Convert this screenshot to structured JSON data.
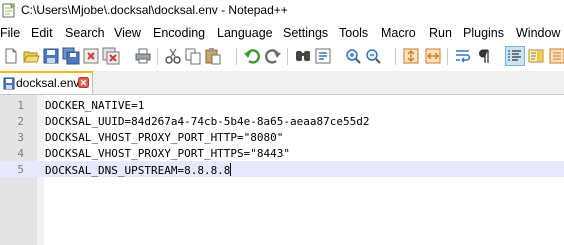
{
  "window": {
    "title": "C:\\Users\\Mjobe\\.docksal\\docksal.env - Notepad++",
    "icon": "notepadpp-icon"
  },
  "menu": [
    "File",
    "Edit",
    "Search",
    "View",
    "Encoding",
    "Language",
    "Settings",
    "Tools",
    "Macro",
    "Run",
    "Plugins",
    "Window"
  ],
  "toolbar": {
    "icons": [
      "new-file-icon",
      "open-file-icon",
      "save-icon",
      "save-all-icon",
      "close-icon",
      "close-all-icon",
      "print-icon",
      "cut-icon",
      "copy-icon",
      "paste-icon",
      "undo-icon",
      "redo-icon",
      "find-icon",
      "replace-icon",
      "zoom-in-icon",
      "zoom-out-icon",
      "sync-vertical-icon",
      "sync-horizontal-icon",
      "word-wrap-icon",
      "show-all-characters-icon",
      "indent-guide-icon",
      "document-map-icon",
      "function-list-icon"
    ]
  },
  "tab": {
    "label": "docksal.env",
    "icon": "saved-file-icon"
  },
  "editor": {
    "lines": [
      {
        "number": "1",
        "text": "DOCKER_NATIVE=1"
      },
      {
        "number": "2",
        "text": "DOCKSAL_UUID=84d267a4-74cb-5b4e-8a65-aeaa87ce55d2"
      },
      {
        "number": "3",
        "text": "DOCKSAL_VHOST_PROXY_PORT_HTTP=\"8080\""
      },
      {
        "number": "4",
        "text": "DOCKSAL_VHOST_PROXY_PORT_HTTPS=\"8443\""
      },
      {
        "number": "5",
        "text": "DOCKSAL_DNS_UPSTREAM=8.8.8.8"
      }
    ],
    "current_line": 5
  },
  "colors": {
    "gutter": "#e4e4e4",
    "current_line": "#e8e8ff",
    "tab_accent": "#f0b429",
    "active_toggle": "#cce4f7"
  }
}
